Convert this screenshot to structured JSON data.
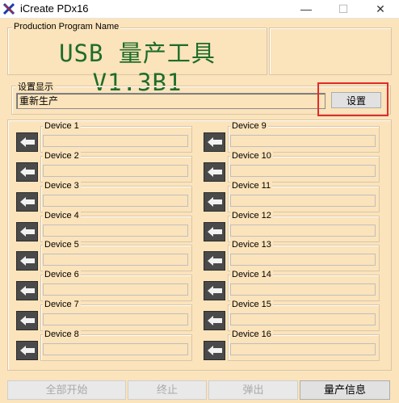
{
  "window": {
    "title": "iCreate PDx16"
  },
  "program": {
    "group_label": "Production Program Name",
    "name": "USB 量产工具 V1.3B1"
  },
  "setting": {
    "group_label": "设置显示",
    "value": "重新生产",
    "button_label": "设置"
  },
  "devices": [
    {
      "label": "Device 1",
      "value": ""
    },
    {
      "label": "Device 2",
      "value": ""
    },
    {
      "label": "Device 3",
      "value": ""
    },
    {
      "label": "Device 4",
      "value": ""
    },
    {
      "label": "Device 5",
      "value": ""
    },
    {
      "label": "Device 6",
      "value": ""
    },
    {
      "label": "Device 7",
      "value": ""
    },
    {
      "label": "Device 8",
      "value": ""
    },
    {
      "label": "Device 9",
      "value": ""
    },
    {
      "label": "Device 10",
      "value": ""
    },
    {
      "label": "Device 11",
      "value": ""
    },
    {
      "label": "Device 12",
      "value": ""
    },
    {
      "label": "Device 13",
      "value": ""
    },
    {
      "label": "Device 14",
      "value": ""
    },
    {
      "label": "Device 15",
      "value": ""
    },
    {
      "label": "Device 16",
      "value": ""
    }
  ],
  "buttons": {
    "start_all": "全部开始",
    "stop": "终止",
    "eject": "弹出",
    "info": "量产信息"
  },
  "colors": {
    "background": "#fbe3bb",
    "title_text": "#1d6d2a",
    "highlight": "#e12b2b"
  }
}
